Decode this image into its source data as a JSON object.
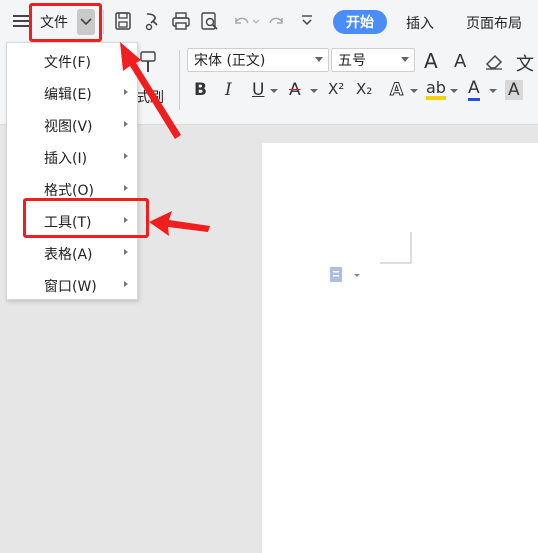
{
  "toolbar": {
    "file_menu_label": "文件"
  },
  "tabs": {
    "start": "开始",
    "insert": "插入",
    "page_layout": "页面布局"
  },
  "ribbon": {
    "format_painter_label": "式刷",
    "font_name": "宋体 (正文)",
    "font_size": "五号",
    "bold": "B",
    "italic": "I",
    "underline": "U",
    "strikethrough": "A",
    "superscript": "X²",
    "subscript": "X₂",
    "text_effect": "A",
    "highlight": "ab",
    "font_color": "A",
    "char_shading": "A",
    "grow_font": "A",
    "shrink_font": "A",
    "pinyin": "文"
  },
  "menu": {
    "items": [
      {
        "label": "文件(F)",
        "has_submenu": false
      },
      {
        "label": "编辑(E)",
        "has_submenu": true
      },
      {
        "label": "视图(V)",
        "has_submenu": true
      },
      {
        "label": "插入(I)",
        "has_submenu": true
      },
      {
        "label": "格式(O)",
        "has_submenu": true
      },
      {
        "label": "工具(T)",
        "has_submenu": true
      },
      {
        "label": "表格(A)",
        "has_submenu": true
      },
      {
        "label": "窗口(W)",
        "has_submenu": true
      }
    ]
  },
  "colors": {
    "accent": "#4a8df8",
    "annotation_red": "#f01e1e",
    "highlight_yellow": "#f5d20c",
    "font_color_red": "#e02020",
    "font_color_blue": "#2050e0"
  }
}
